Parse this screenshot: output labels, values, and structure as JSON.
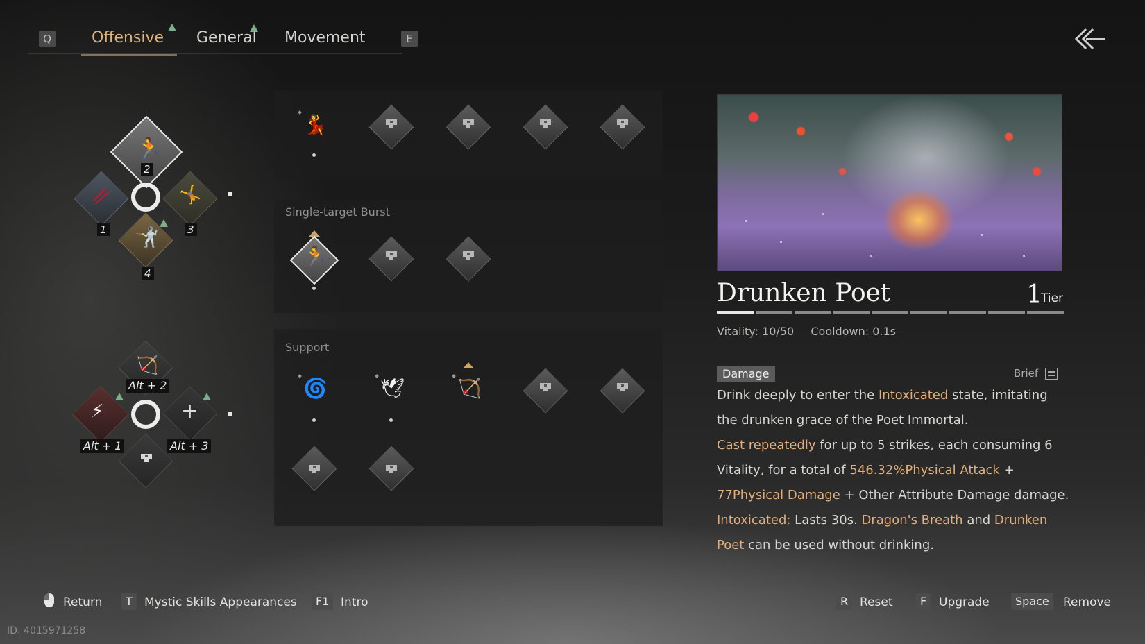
{
  "tabs": {
    "prev_key": "Q",
    "next_key": "E",
    "items": [
      {
        "label": "Offensive",
        "active": true,
        "has_new": true
      },
      {
        "label": "General",
        "active": false,
        "has_new": true
      },
      {
        "label": "Movement",
        "active": false,
        "has_new": false
      }
    ]
  },
  "back_icon": "double-chevron-left-icon",
  "wheel_primary": {
    "slots": [
      {
        "key": "2",
        "icon": "leaping-figure-icon",
        "selected": true
      },
      {
        "key": "1",
        "icon": "drinking-figure-icon"
      },
      {
        "key": "3",
        "icon": "crouching-figure-icon"
      },
      {
        "key": "4",
        "icon": "spinning-figure-icon",
        "has_new": true
      }
    ]
  },
  "wheel_alt": {
    "slots": [
      {
        "key": "Alt + 2",
        "icon": "archer-figure-icon"
      },
      {
        "key": "Alt + 1",
        "icon": "claw-icon",
        "has_new": true
      },
      {
        "key": "Alt + 3",
        "icon": "plus-icon",
        "has_new": true
      },
      {
        "key": "",
        "icon": "lock-icon"
      }
    ]
  },
  "categories": [
    {
      "title": "",
      "slots": [
        {
          "state": "filled",
          "icon": "dancing-figure-icon",
          "equipped": true
        },
        {
          "state": "locked",
          "icon": "lock-icon"
        },
        {
          "state": "locked",
          "icon": "lock-icon"
        },
        {
          "state": "locked",
          "icon": "lock-icon"
        },
        {
          "state": "locked",
          "icon": "lock-icon"
        }
      ]
    },
    {
      "title": "Single-target Burst",
      "slots": [
        {
          "state": "selected",
          "icon": "drunken-poet-icon",
          "equipped": true
        },
        {
          "state": "locked",
          "icon": "lock-icon"
        },
        {
          "state": "locked",
          "icon": "lock-icon"
        }
      ]
    },
    {
      "title": "Support",
      "slots": [
        {
          "state": "filled",
          "icon": "cloud-swirl-icon",
          "equipped": true
        },
        {
          "state": "filled",
          "icon": "bird-wing-icon",
          "equipped": true
        },
        {
          "state": "filled",
          "icon": "archer-figure-icon",
          "upgrade": true
        },
        {
          "state": "locked",
          "icon": "lock-icon"
        },
        {
          "state": "locked",
          "icon": "lock-icon"
        },
        {
          "state": "locked",
          "icon": "lock-icon"
        },
        {
          "state": "locked",
          "icon": "lock-icon"
        }
      ]
    }
  ],
  "detail": {
    "name": "Drunken Poet",
    "tier_value": "1",
    "tier_label": "Tier",
    "tier_segments_total": 9,
    "tier_segments_filled": 1,
    "vitality": "Vitality: 10/50",
    "cooldown": "Cooldown: 0.1s",
    "badge": "Damage",
    "brief_label": "Brief",
    "lines": [
      [
        {
          "t": "Drink deeply to enter the ",
          "h": false
        },
        {
          "t": "Intoxicated",
          "h": true
        },
        {
          "t": " state, imitating",
          "h": false
        }
      ],
      [
        {
          "t": "the drunken grace of the Poet Immortal.",
          "h": false
        }
      ],
      [
        {
          "t": "Cast repeatedly",
          "h": true
        },
        {
          "t": " for up to 5 strikes, each consuming 6",
          "h": false
        }
      ],
      [
        {
          "t": "Vitality, for a total of ",
          "h": false
        },
        {
          "t": "546.32%Physical Attack",
          "h": true
        },
        {
          "t": " +",
          "h": false
        }
      ],
      [
        {
          "t": "77Physical Damage",
          "h": true
        },
        {
          "t": " + Other Attribute Damage damage.",
          "h": false
        }
      ],
      [
        {
          "t": "Intoxicated:",
          "h": true
        },
        {
          "t": " Lasts 30s. ",
          "h": false
        },
        {
          "t": "Dragon's Breath",
          "h": true
        },
        {
          "t": " and ",
          "h": false
        },
        {
          "t": "Drunken",
          "h": true
        }
      ],
      [
        {
          "t": "Poet",
          "h": true
        },
        {
          "t": " can be used without drinking.",
          "h": false
        }
      ]
    ]
  },
  "footer": {
    "return_label": "Return",
    "appearances_key": "T",
    "appearances_label": "Mystic Skills Appearances",
    "intro_key": "F1",
    "intro_label": "Intro",
    "reset_key": "R",
    "reset_label": "Reset",
    "upgrade_key": "F",
    "upgrade_label": "Upgrade",
    "remove_key": "Space",
    "remove_label": "Remove"
  },
  "uid": "ID: 4015971258"
}
